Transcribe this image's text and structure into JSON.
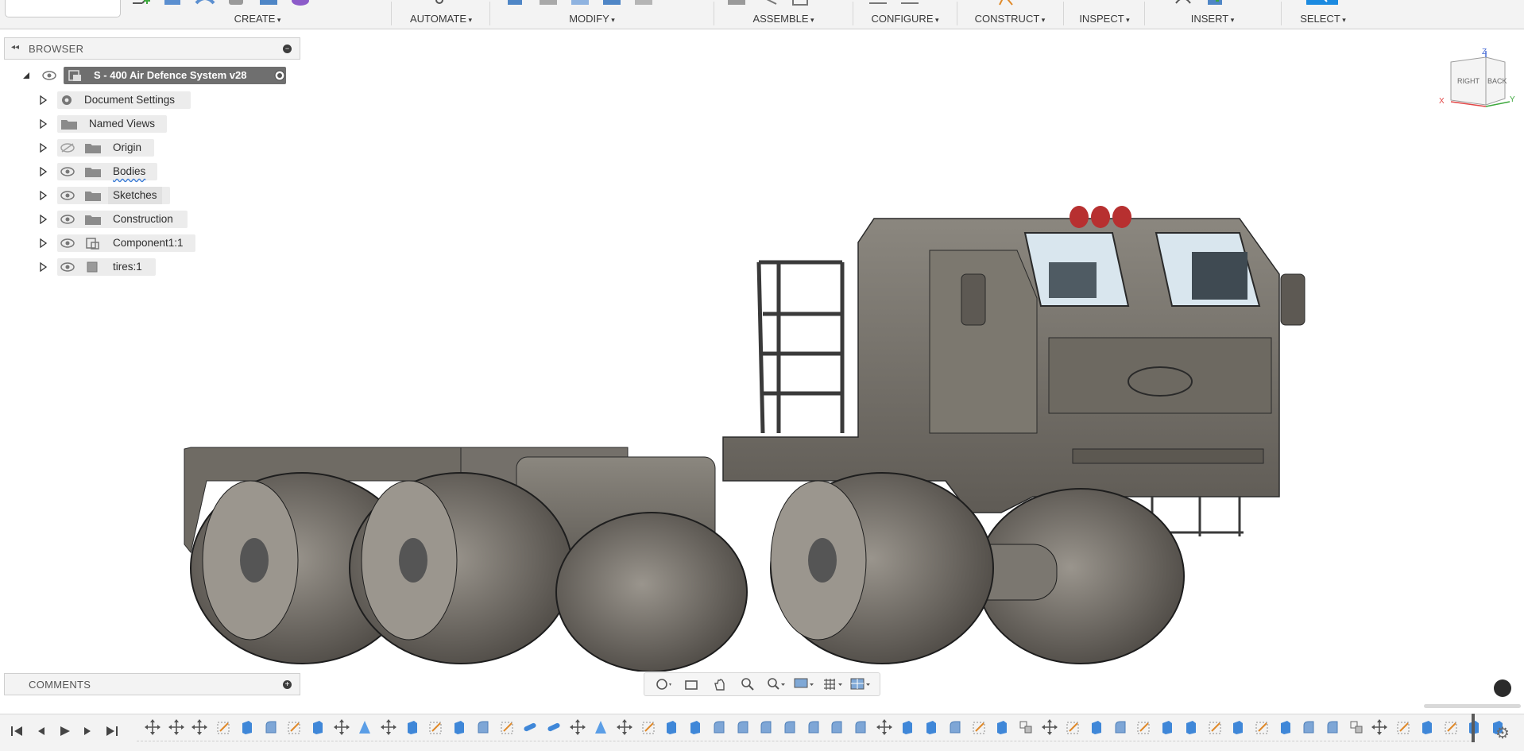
{
  "toolbar": {
    "groups": [
      {
        "label": "CREATE"
      },
      {
        "label": "AUTOMATE"
      },
      {
        "label": "MODIFY"
      },
      {
        "label": "ASSEMBLE"
      },
      {
        "label": "CONFIGURE"
      },
      {
        "label": "CONSTRUCT"
      },
      {
        "label": "INSPECT"
      },
      {
        "label": "INSERT"
      },
      {
        "label": "SELECT"
      }
    ]
  },
  "browser": {
    "title": "BROWSER",
    "root": {
      "label": "S - 400 Air Defence System v28"
    },
    "items": [
      {
        "label": "Document Settings",
        "icon": "gear-icon"
      },
      {
        "label": "Named Views",
        "icon": "folder-icon"
      },
      {
        "label": "Origin",
        "icon": "folder-icon",
        "visible": false
      },
      {
        "label": "Bodies",
        "icon": "folder-icon"
      },
      {
        "label": "Sketches",
        "icon": "folder-icon"
      },
      {
        "label": "Construction",
        "icon": "folder-icon"
      },
      {
        "label": "Component1:1",
        "icon": "component-icon"
      },
      {
        "label": "tires:1",
        "icon": "body-icon"
      }
    ]
  },
  "comments": {
    "title": "COMMENTS"
  },
  "viewcube": {
    "top": "Z",
    "right_face": "RIGHT",
    "back_face": "BACK",
    "axis_x": "X",
    "axis_y": "Y"
  },
  "colors": {
    "accent": "#1b8ae0",
    "browser_root": "#6f6f6f",
    "model_body": "#7b7770",
    "light_red": "#b73030"
  }
}
